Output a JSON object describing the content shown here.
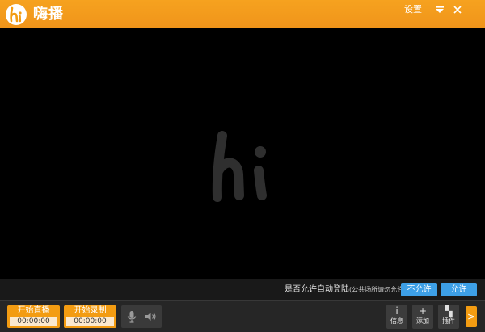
{
  "app": {
    "title": "嗨播",
    "settings_label": "设置",
    "brand_color": "#f39c12",
    "icons": [
      "hi-logo-icon",
      "dropdown-menu-icon",
      "close-icon"
    ]
  },
  "login_bar": {
    "prompt": "是否允许自动登陆",
    "note": "(公共场所请勿允许)",
    "deny_label": "不允许",
    "allow_label": "允许",
    "button_color": "#3d9fe6"
  },
  "controls": {
    "start_live": {
      "label": "开始直播",
      "time": "00:00:00"
    },
    "start_record": {
      "label": "开始录制",
      "time": "00:00:00"
    },
    "microphone_icon": "microphone-icon",
    "speaker_icon": "speaker-icon",
    "tools": [
      {
        "label": "信息",
        "glyph": "i",
        "icon": "info-icon"
      },
      {
        "label": "添加",
        "glyph": "+",
        "icon": "add-icon"
      },
      {
        "label": "插件",
        "glyph": "▚",
        "icon": "plugin-icon"
      }
    ],
    "expand_glyph": ">"
  }
}
